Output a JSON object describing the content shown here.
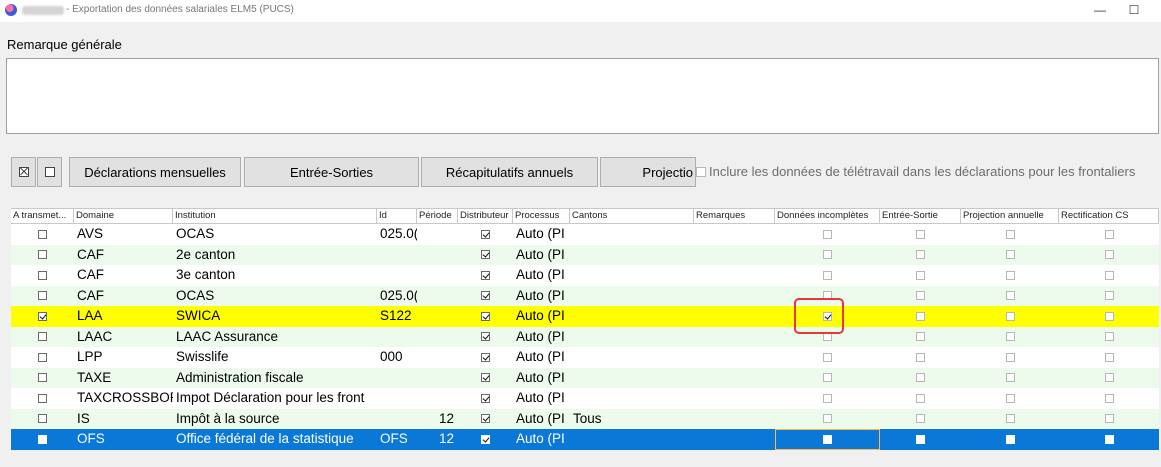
{
  "window": {
    "title": "- Exportation des données salariales ELM5 (PUCS)",
    "minimize_glyph": "—",
    "maximize_glyph": "☐"
  },
  "remark": {
    "label": "Remarque générale",
    "value": ""
  },
  "toolbar": {
    "check_all_icon": "checkbox-x-icon",
    "uncheck_all_icon": "checkbox-empty-icon",
    "buttons": [
      "Déclarations mensuelles",
      "Entrée-Sorties",
      "Récapitulatifs annuels",
      "Projectio"
    ],
    "telework_label": "Inclure les données de télétravail dans les déclarations pour les frontaliers",
    "telework_checked": false
  },
  "table": {
    "columns": [
      "A transmet...",
      "Domaine",
      "Institution",
      "Id",
      "Période",
      "Distributeur",
      "Processus",
      "Cantons",
      "Remarques",
      "Données incomplètes",
      "Entrée-Sortie",
      "Projection annuelle",
      "Rectification CS"
    ],
    "rows": [
      {
        "transmit": false,
        "domaine": "AVS",
        "institution": "OCAS",
        "id": "025.0(",
        "periode": "",
        "distributeur": true,
        "processus": "Auto (PI",
        "cantons": "",
        "remarques": "",
        "incompletes": false,
        "entree_sortie": false,
        "projection": false,
        "rectification": false
      },
      {
        "transmit": false,
        "domaine": "CAF",
        "institution": "2e canton",
        "id": "",
        "periode": "",
        "distributeur": true,
        "processus": "Auto (PI",
        "cantons": "",
        "remarques": "",
        "incompletes": false,
        "entree_sortie": false,
        "projection": false,
        "rectification": false
      },
      {
        "transmit": false,
        "domaine": "CAF",
        "institution": "3e canton",
        "id": "",
        "periode": "",
        "distributeur": true,
        "processus": "Auto (PI",
        "cantons": "",
        "remarques": "",
        "incompletes": false,
        "entree_sortie": false,
        "projection": false,
        "rectification": false
      },
      {
        "transmit": false,
        "domaine": "CAF",
        "institution": "OCAS",
        "id": "025.0(",
        "periode": "",
        "distributeur": true,
        "processus": "Auto (PI",
        "cantons": "",
        "remarques": "",
        "incompletes": false,
        "entree_sortie": false,
        "projection": false,
        "rectification": false
      },
      {
        "transmit": true,
        "domaine": "LAA",
        "institution": "SWICA",
        "id": "S122",
        "periode": "",
        "distributeur": true,
        "processus": "Auto (PI",
        "cantons": "",
        "remarques": "",
        "incompletes": true,
        "entree_sortie": false,
        "projection": false,
        "rectification": false,
        "highlight": true
      },
      {
        "transmit": false,
        "domaine": "LAAC",
        "institution": "LAAC Assurance",
        "id": "",
        "periode": "",
        "distributeur": true,
        "processus": "Auto (PI",
        "cantons": "",
        "remarques": "",
        "incompletes": false,
        "entree_sortie": false,
        "projection": false,
        "rectification": false
      },
      {
        "transmit": false,
        "domaine": "LPP",
        "institution": "Swisslife",
        "id": "000",
        "periode": "",
        "distributeur": true,
        "processus": "Auto (PI",
        "cantons": "",
        "remarques": "",
        "incompletes": false,
        "entree_sortie": false,
        "projection": false,
        "rectification": false
      },
      {
        "transmit": false,
        "domaine": "TAXE",
        "institution": "Administration fiscale",
        "id": "",
        "periode": "",
        "distributeur": true,
        "processus": "Auto (PI",
        "cantons": "",
        "remarques": "",
        "incompletes": false,
        "entree_sortie": false,
        "projection": false,
        "rectification": false
      },
      {
        "transmit": false,
        "domaine": "TAXCROSSBOR",
        "institution": "Impot Déclaration pour les front",
        "id": "",
        "periode": "",
        "distributeur": true,
        "processus": "Auto (PI",
        "cantons": "",
        "remarques": "",
        "incompletes": false,
        "entree_sortie": false,
        "projection": false,
        "rectification": false
      },
      {
        "transmit": false,
        "domaine": "IS",
        "institution": "Impôt à la source",
        "id": "",
        "periode": "12",
        "distributeur": true,
        "processus": "Auto (PI",
        "cantons": "Tous",
        "remarques": "",
        "incompletes": false,
        "entree_sortie": false,
        "projection": false,
        "rectification": false
      },
      {
        "transmit": false,
        "domaine": "OFS",
        "institution": "Office fédéral de la statistique",
        "id": "OFS",
        "periode": "12",
        "distributeur": true,
        "processus": "Auto (PI",
        "cantons": "",
        "remarques": "",
        "incompletes": false,
        "entree_sortie": false,
        "projection": false,
        "rectification": false,
        "selected": true
      }
    ]
  },
  "colors": {
    "highlight_row": "#ffff00",
    "selected_row": "#0a78d7",
    "alternate_row": "#ecfbec",
    "annotation_circle": "#e53935"
  }
}
